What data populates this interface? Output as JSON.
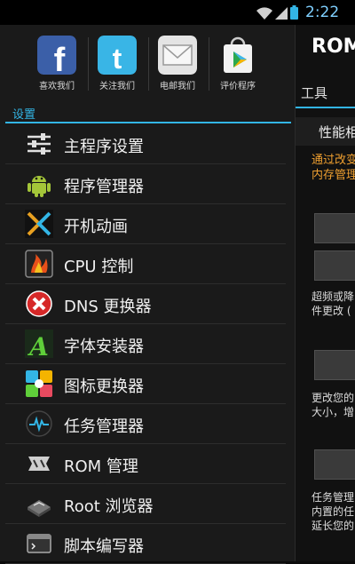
{
  "status": {
    "time": "2:22"
  },
  "share": [
    {
      "label": "喜欢我们",
      "icon": "facebook-icon"
    },
    {
      "label": "关注我们",
      "icon": "twitter-icon"
    },
    {
      "label": "电邮我们",
      "icon": "mail-icon"
    },
    {
      "label": "评价程序",
      "icon": "play-store-icon"
    }
  ],
  "section": "设置",
  "menu": [
    {
      "label": "主程序设置",
      "icon": "sliders-icon"
    },
    {
      "label": "程序管理器",
      "icon": "android-icon"
    },
    {
      "label": "开机动画",
      "icon": "boot-animation-icon"
    },
    {
      "label": "CPU 控制",
      "icon": "cpu-icon"
    },
    {
      "label": "DNS 更换器",
      "icon": "dns-icon"
    },
    {
      "label": "字体安装器",
      "icon": "font-icon"
    },
    {
      "label": "图标更换器",
      "icon": "icon-changer-icon"
    },
    {
      "label": "任务管理器",
      "icon": "task-manager-icon"
    },
    {
      "label": "ROM 管理",
      "icon": "rom-icon"
    },
    {
      "label": "Root 浏览器",
      "icon": "root-browser-icon"
    },
    {
      "label": "脚本编写器",
      "icon": "script-icon"
    }
  ],
  "right": {
    "title": "ROM",
    "tab": "工具",
    "card": "性能相",
    "orange": "通过改变\n内存管理",
    "note1": "超频或降\n件更改 (",
    "note2": "更改您的\n大小，增",
    "note3": "任务管理\n内置的任\n延长您的"
  },
  "colors": {
    "accent": "#33b5e5",
    "orange": "#f0a030"
  }
}
